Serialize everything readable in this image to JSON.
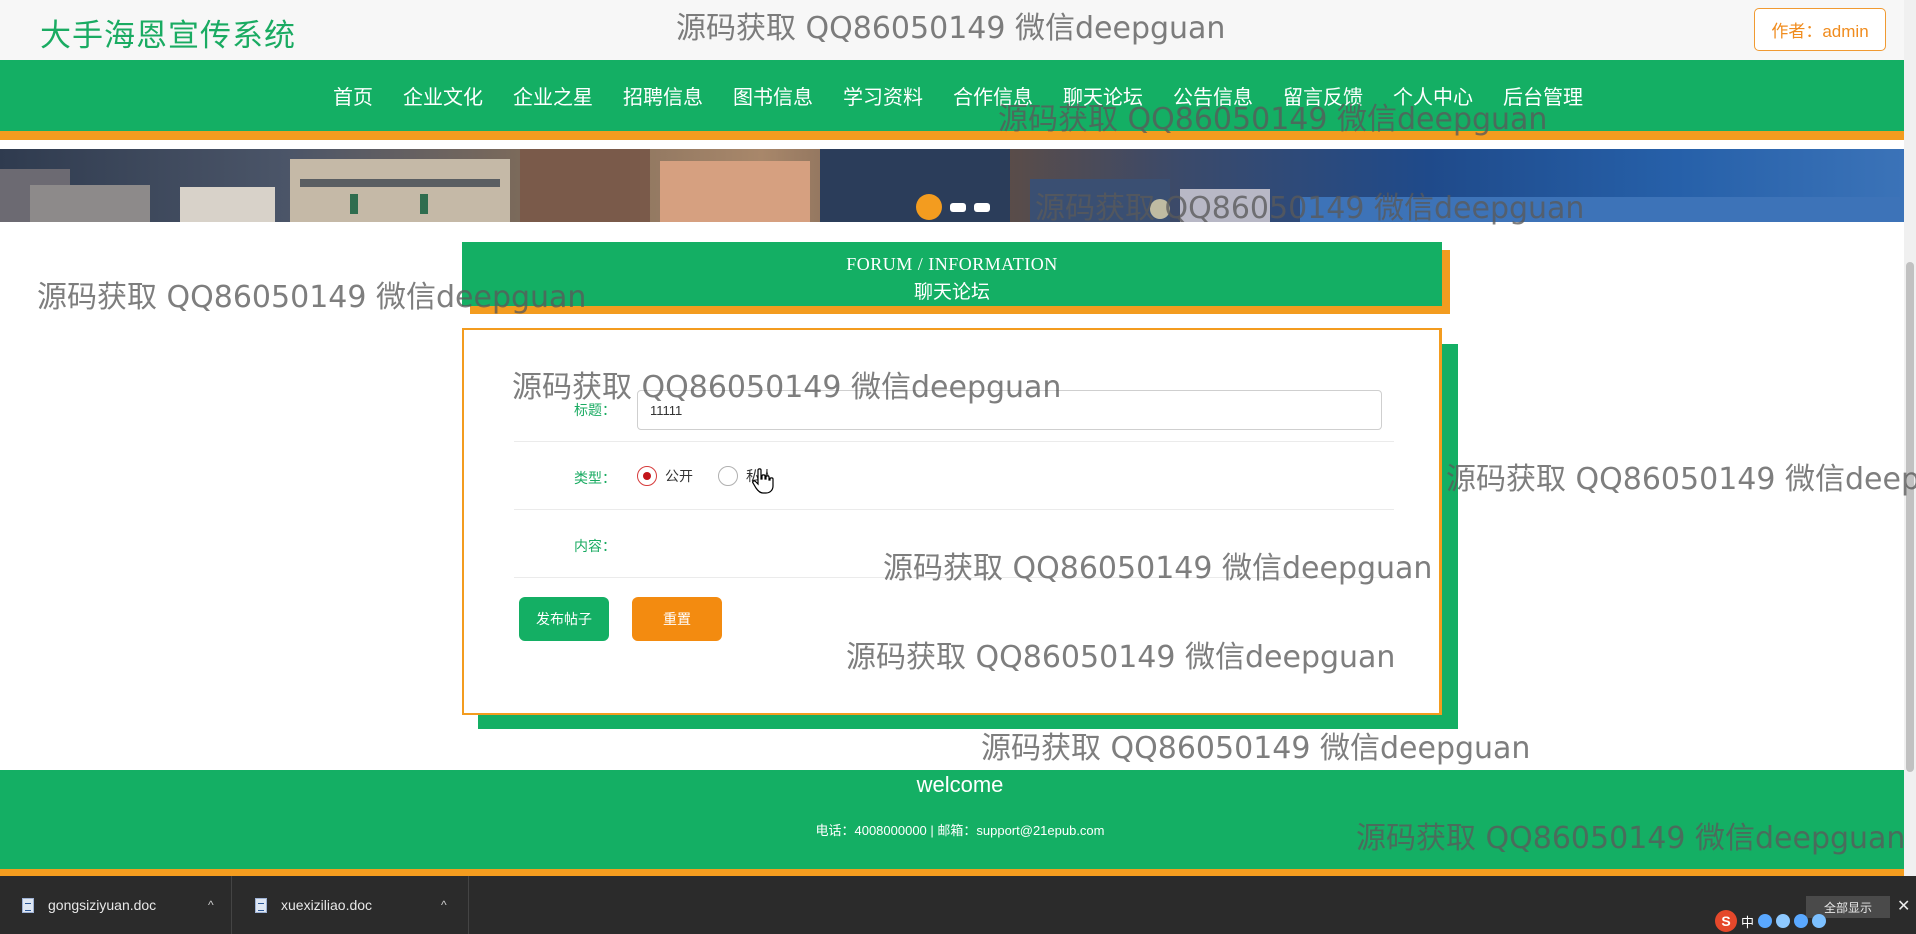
{
  "header": {
    "site_title": "大手海恩宣传系统",
    "author_label": "作者：admin"
  },
  "nav": {
    "items": [
      "首页",
      "企业文化",
      "企业之星",
      "招聘信息",
      "图书信息",
      "学习资料",
      "合作信息",
      "聊天论坛",
      "公告信息",
      "留言反馈",
      "个人中心",
      "后台管理"
    ]
  },
  "carousel": {
    "active_index": 0,
    "count": 3
  },
  "forum": {
    "heading_en": "FORUM / INFORMATION",
    "heading_cn": "聊天论坛",
    "fields": {
      "title_label": "标题：",
      "title_value": "11111",
      "type_label": "类型：",
      "type_options": [
        "公开",
        "私人"
      ],
      "type_selected": "公开",
      "content_label": "内容："
    },
    "buttons": {
      "publish": "发布帖子",
      "reset": "重置"
    }
  },
  "footer": {
    "title": "welcome",
    "contact": "电话：4008000000 | 邮箱：support@21epub.com"
  },
  "watermark": {
    "text": "源码获取 QQ86050149 微信deepguan"
  },
  "download_bar": {
    "files": [
      "gongsiziyuan.doc",
      "xuexiziliao.doc"
    ],
    "show_all": "全部显示",
    "close": "✕"
  },
  "tray": {
    "ime_logo": "S",
    "ime_lang": "中"
  },
  "colors": {
    "green": "#14af64",
    "orange": "#f39c1f",
    "title_green": "#1aab62"
  }
}
